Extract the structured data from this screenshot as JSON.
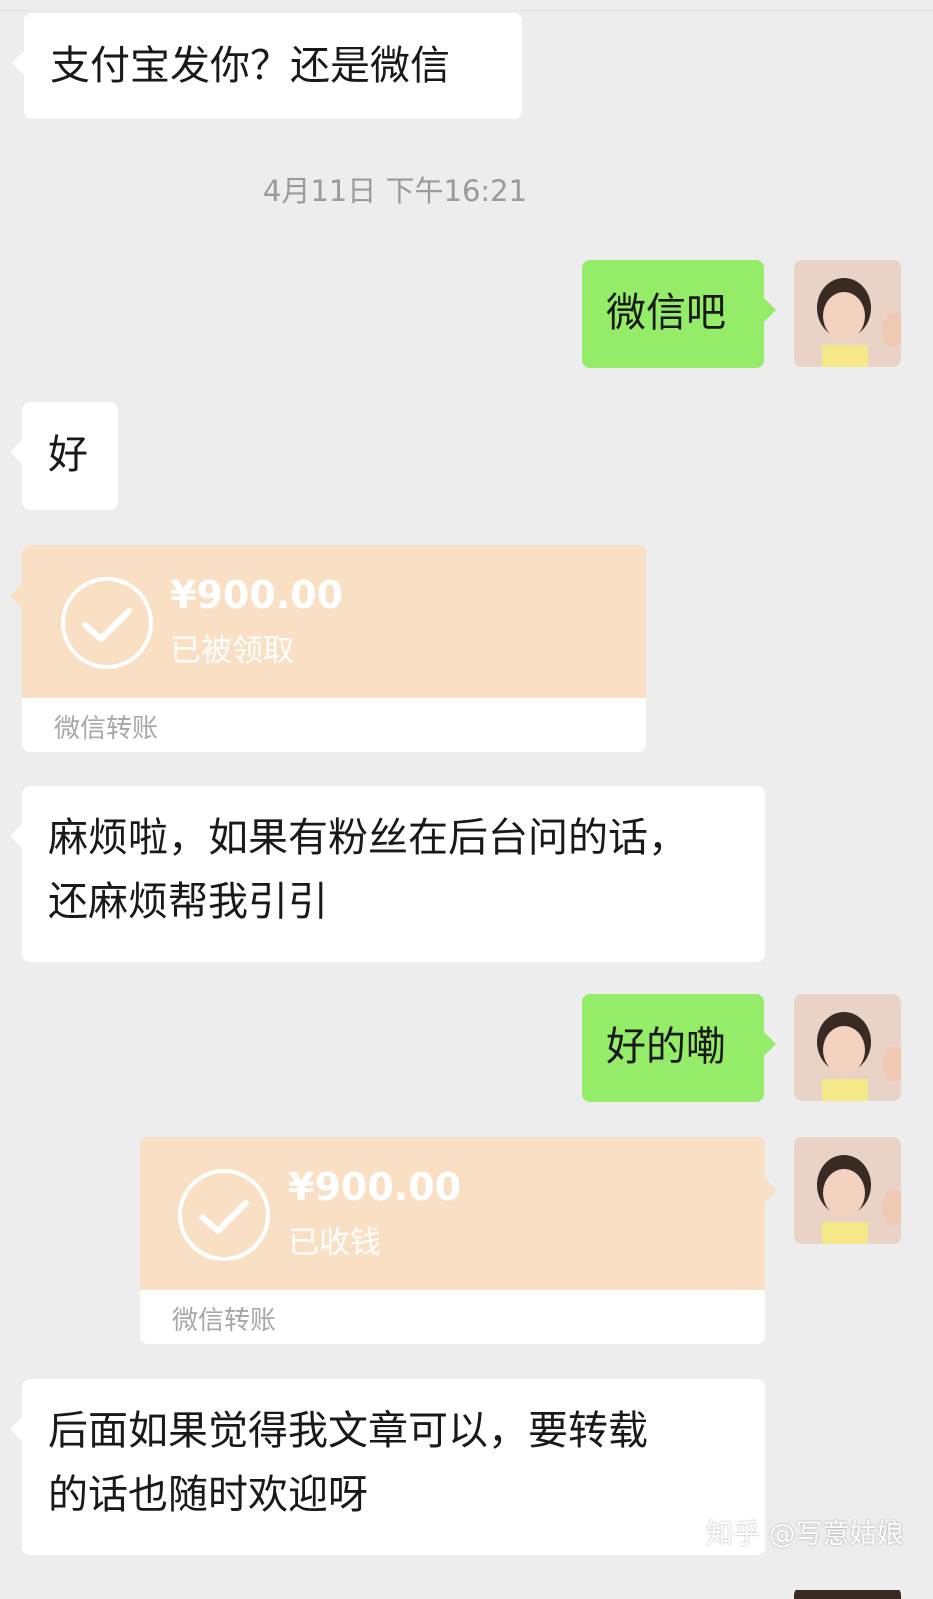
{
  "messages": {
    "m1": "支付宝发你？还是微信",
    "timestamp": "4月11日 下午16:21",
    "m2": "微信吧",
    "m3": "好",
    "transfer1": {
      "amount": "¥900.00",
      "status": "已被领取",
      "label": "微信转账"
    },
    "m4_line1": "麻烦啦，如果有粉丝在后台问的话，",
    "m4_line2": "还麻烦帮我引引",
    "m5": "好的嘞",
    "transfer2": {
      "amount": "¥900.00",
      "status": "已收钱",
      "label": "微信转账"
    },
    "m6_line1": "后面如果觉得我文章可以，要转载",
    "m6_line2": "的话也随时欢迎呀"
  },
  "watermark": "知乎 @写意姑娘",
  "colors": {
    "background": "#ededed",
    "sent_bubble": "#95ec69",
    "received_bubble": "#ffffff",
    "transfer_card": "#f9e0c4"
  },
  "icons": [
    "check-circle-icon",
    "avatar"
  ]
}
